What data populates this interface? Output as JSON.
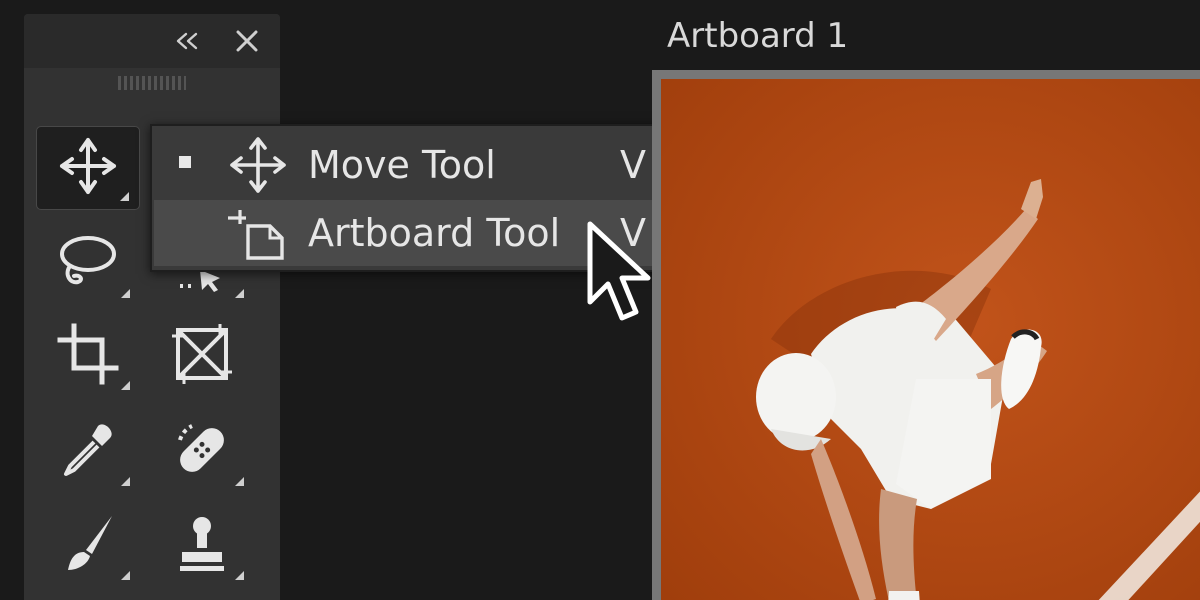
{
  "tools_panel": {
    "collapse_icon": "double-chevron-left-icon",
    "close_icon": "close-icon",
    "tools": [
      {
        "name": "move-tool",
        "icon": "move-icon",
        "active": true
      },
      {
        "name": "lasso-tool",
        "icon": "lasso-icon",
        "active": false
      },
      {
        "name": "object-selection-tool",
        "icon": "object-selection-icon",
        "active": false
      },
      {
        "name": "crop-tool",
        "icon": "crop-icon",
        "active": false
      },
      {
        "name": "frame-tool",
        "icon": "frame-icon",
        "active": false
      },
      {
        "name": "eyedropper-tool",
        "icon": "eyedropper-icon",
        "active": false
      },
      {
        "name": "spot-healing-brush-tool",
        "icon": "bandage-icon",
        "active": false
      },
      {
        "name": "brush-tool",
        "icon": "brush-icon",
        "active": false
      },
      {
        "name": "clone-stamp-tool",
        "icon": "stamp-icon",
        "active": false
      }
    ]
  },
  "flyout_menu": {
    "items": [
      {
        "label": "Move Tool",
        "shortcut": "V",
        "icon": "move-icon",
        "selected": true
      },
      {
        "label": "Artboard Tool",
        "shortcut": "V",
        "icon": "artboard-icon",
        "selected": false,
        "hovered": true
      }
    ]
  },
  "artboard": {
    "title": "Artboard 1",
    "image": "tennis-player-clay-court-photo"
  },
  "colors": {
    "app_background": "#1a1a1a",
    "panel_background": "#323232",
    "menu_background": "#3a3a3a",
    "menu_hover": "#4a4a4a",
    "clay_court": "#b5490f",
    "text": "#e6e6e6"
  }
}
